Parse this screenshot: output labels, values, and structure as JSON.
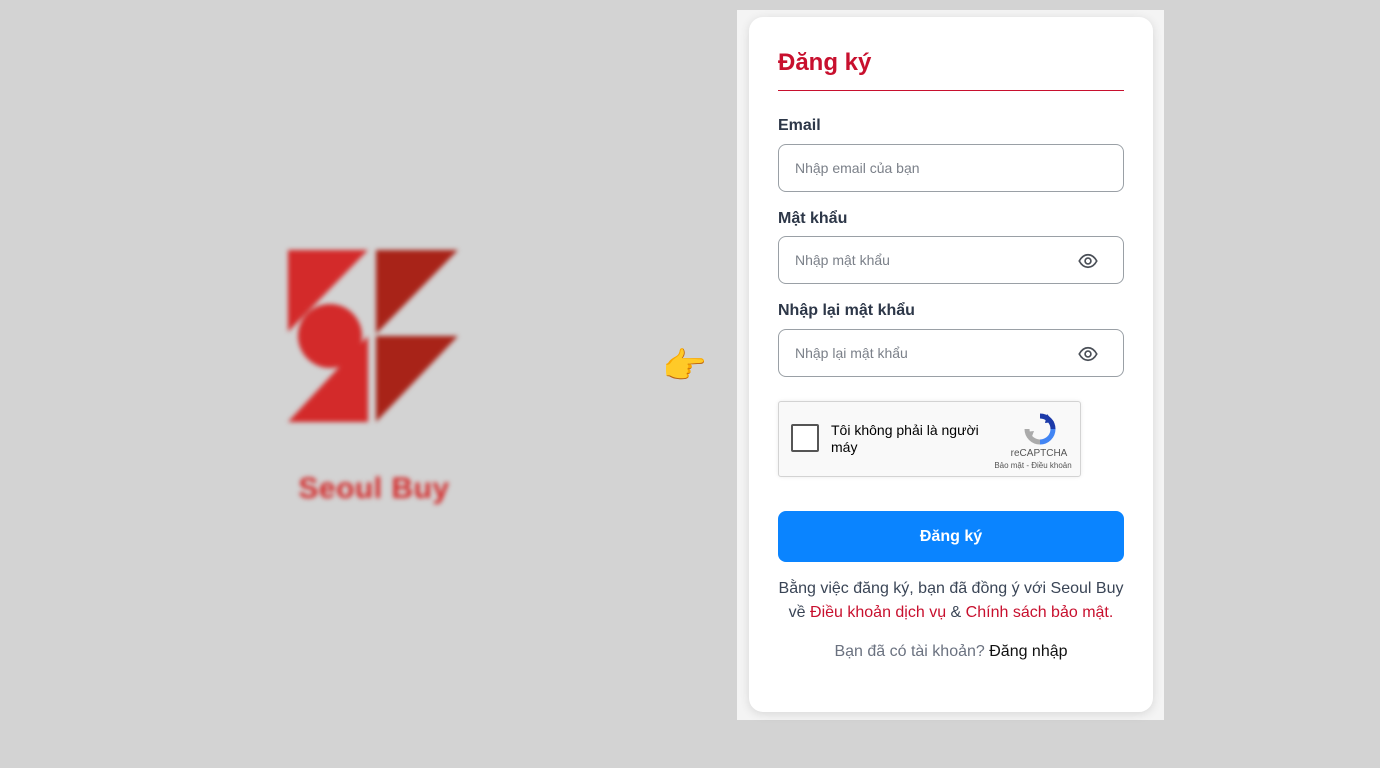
{
  "brand": {
    "name": "Seoul Buy",
    "logo_color_primary": "#d32a2a",
    "logo_color_secondary": "#a82318"
  },
  "pointer_emoji": "👉",
  "form": {
    "title": "Đăng ký",
    "email": {
      "label": "Email",
      "placeholder": "Nhập email của bạn",
      "value": ""
    },
    "password": {
      "label": "Mật khẩu",
      "placeholder": "Nhập mật khẩu",
      "value": "",
      "toggle_icon": "eye-icon"
    },
    "confirm_password": {
      "label": "Nhập lại mật khẩu",
      "placeholder": "Nhập lại mật khẩu",
      "value": "",
      "toggle_icon": "eye-icon"
    },
    "captcha": {
      "label": "Tôi không phải là người máy",
      "brand": "reCAPTCHA",
      "links": "Bảo mật - Điều khoản",
      "checked": false
    },
    "submit_label": "Đăng ký",
    "terms": {
      "prefix": "Bằng việc đăng ký, bạn đã đồng ý với Seoul Buy về ",
      "terms_link": "Điều khoản dịch vụ",
      "conjunction": " & ",
      "privacy_link": "Chính sách bảo mật."
    },
    "login": {
      "prompt": "Bạn đã có tài khoản? ",
      "link": "Đăng nhập"
    }
  },
  "colors": {
    "accent": "#c8102e",
    "button": "#0a84ff",
    "background": "#d3d3d3"
  }
}
